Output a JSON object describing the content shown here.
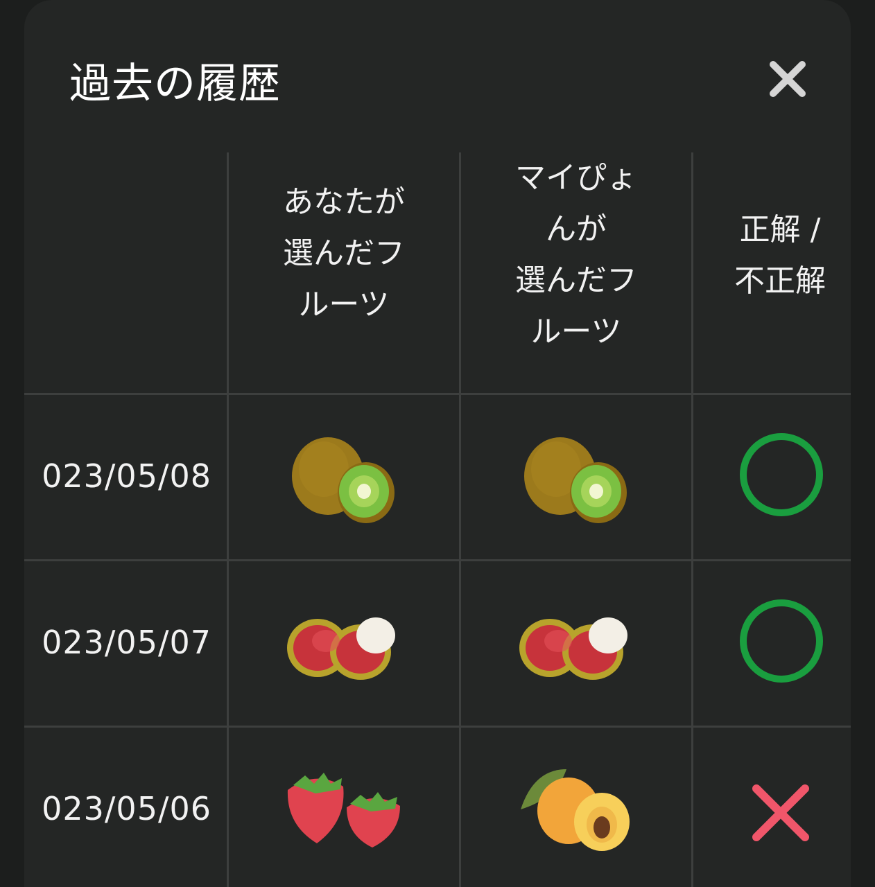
{
  "modal": {
    "title": "過去の履歴",
    "close_icon": "close-icon"
  },
  "table": {
    "headers": {
      "date": "",
      "your_fruit": "あなたが\n選んだフ\nルーツ",
      "mypiyo_fruit": "マイぴょ\nんが\n選んだフ\nルーツ",
      "result": "正解 /\n不正解"
    },
    "rows": [
      {
        "date": "023/05/08",
        "your_fruit": "kiwi",
        "mypiyo_fruit": "kiwi",
        "result": "correct"
      },
      {
        "date": "023/05/07",
        "your_fruit": "rambutan",
        "mypiyo_fruit": "rambutan",
        "result": "correct"
      },
      {
        "date": "023/05/06",
        "your_fruit": "strawberry",
        "mypiyo_fruit": "loquat",
        "result": "incorrect"
      }
    ]
  },
  "colors": {
    "background": "#242625",
    "grid": "#3d3f3e",
    "correct": "#1a9e3f",
    "incorrect": "#f0566a",
    "close": "#d5d5d5"
  }
}
